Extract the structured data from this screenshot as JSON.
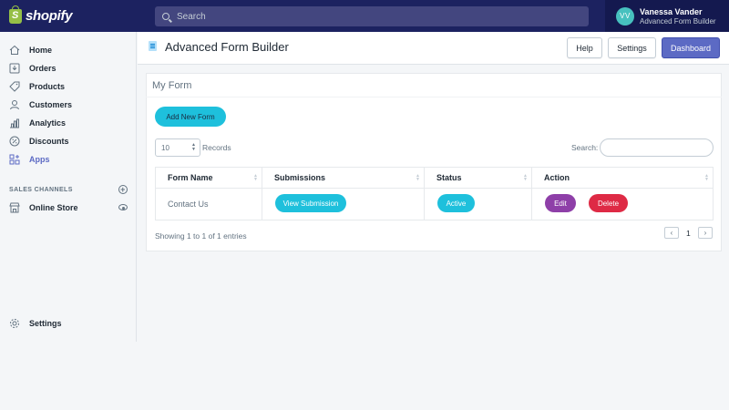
{
  "topbar": {
    "logo_text": "shopify",
    "search_placeholder": "Search",
    "user_initials": "VV",
    "user_name": "Vanessa Vander",
    "user_store": "Advanced Form Builder"
  },
  "sidebar": {
    "items": [
      {
        "label": "Home",
        "icon": "home-icon"
      },
      {
        "label": "Orders",
        "icon": "orders-icon"
      },
      {
        "label": "Products",
        "icon": "tag-icon"
      },
      {
        "label": "Customers",
        "icon": "person-icon"
      },
      {
        "label": "Analytics",
        "icon": "bar-chart-icon"
      },
      {
        "label": "Discounts",
        "icon": "discount-icon"
      },
      {
        "label": "Apps",
        "icon": "apps-icon"
      }
    ],
    "sales_channels_heading": "SALES CHANNELS",
    "online_store_label": "Online Store",
    "settings_label": "Settings"
  },
  "header": {
    "title": "Advanced Form Builder",
    "help_label": "Help",
    "settings_label": "Settings",
    "dashboard_label": "Dashboard"
  },
  "card": {
    "title": "My Form",
    "add_button_label": "Add New Form",
    "records_value": "10",
    "records_label": "Records",
    "search_label": "Search:",
    "columns": [
      "Form Name",
      "Submissions",
      "Status",
      "Action"
    ],
    "rows": [
      {
        "form_name": "Contact Us",
        "submissions_label": "View Submission",
        "status_label": "Active",
        "edit_label": "Edit",
        "delete_label": "Delete"
      }
    ],
    "showing_text": "Showing 1 to 1 of 1 entries",
    "pager": {
      "prev": "‹",
      "page": "1",
      "next": "›"
    }
  },
  "colors": {
    "topbar": "#1c2260",
    "primary": "#5c6ac4",
    "cyan": "#1ec0dc",
    "purple": "#8e3fa8",
    "red": "#de2a45"
  }
}
